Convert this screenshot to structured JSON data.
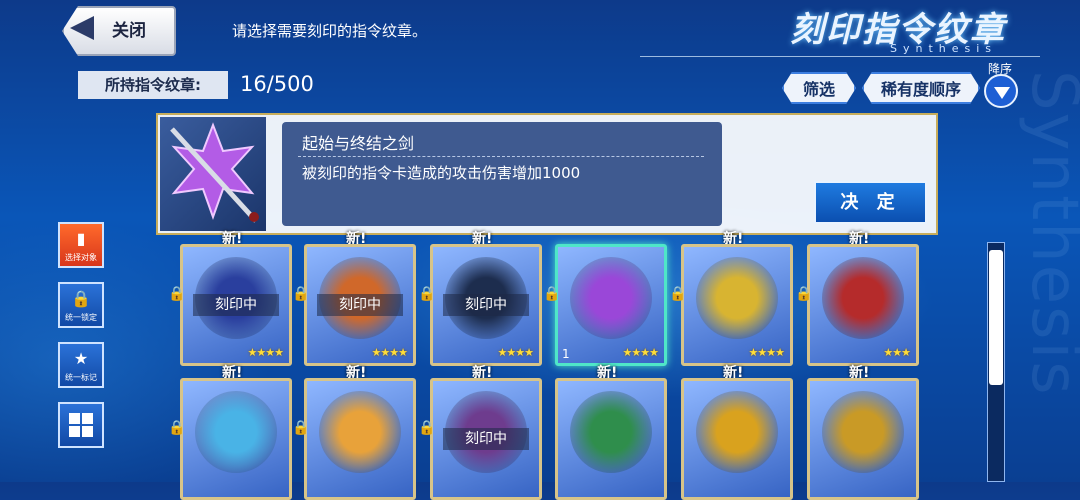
{
  "header": {
    "close_label": "关闭",
    "instruction": "请选择需要刻印的指令纹章。",
    "title": "刻印指令纹章",
    "subtitle": "Synthesis"
  },
  "watermark": "Synthesis",
  "toolbar": {
    "owned_label": "所持指令纹章:",
    "owned_count": "16/500",
    "filter_label": "筛选",
    "sort_label": "稀有度顺序",
    "order_label": "降序"
  },
  "detail": {
    "name": "起始与终结之剑",
    "description": "被刻印的指令卡造成的攻击伤害增加1000",
    "confirm_label": "决 定"
  },
  "side": {
    "select_target": "选择对象",
    "lock_all": "统一锁定",
    "mark_all": "统一标记"
  },
  "cards_row1": [
    {
      "new": "新!",
      "label": "刻印中",
      "stars": "★★★★",
      "locked": true,
      "color": "#2a3f9e"
    },
    {
      "new": "新!",
      "label": "刻印中",
      "stars": "★★★★",
      "locked": true,
      "color": "#d0682a"
    },
    {
      "new": "新!",
      "label": "刻印中",
      "stars": "★★★★",
      "locked": true,
      "color": "#1d2d4e"
    },
    {
      "new": "",
      "label": "",
      "stars": "★★★★",
      "locked": true,
      "index": "1",
      "color": "#9a47d8"
    },
    {
      "new": "新!",
      "label": "",
      "stars": "★★★★",
      "locked": true,
      "color": "#d8b431"
    },
    {
      "new": "新!",
      "label": "",
      "stars": "★★★",
      "locked": true,
      "color": "#b52b2b"
    }
  ],
  "cards_row2": [
    {
      "new": "新!",
      "label": "",
      "stars": "",
      "locked": true,
      "color": "#49b3e6"
    },
    {
      "new": "新!",
      "label": "",
      "stars": "",
      "locked": true,
      "color": "#e8a23a"
    },
    {
      "new": "新!",
      "label": "刻印中",
      "stars": "",
      "locked": true,
      "color": "#6e3c8e"
    },
    {
      "new": "新!",
      "label": "",
      "stars": "",
      "locked": false,
      "color": "#2f8e4c"
    },
    {
      "new": "新!",
      "label": "",
      "stars": "",
      "locked": false,
      "color": "#d9a21e"
    },
    {
      "new": "新!",
      "label": "",
      "stars": "",
      "locked": false,
      "color": "#c99a26"
    }
  ]
}
